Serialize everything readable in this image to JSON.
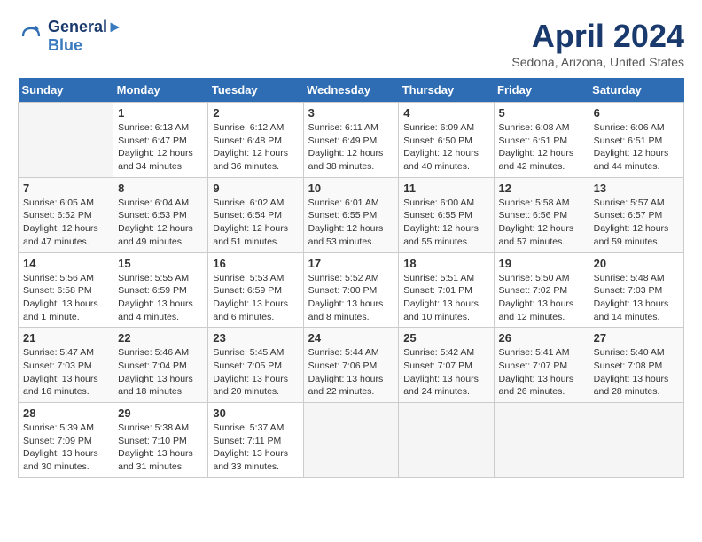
{
  "header": {
    "logo_line1": "General",
    "logo_line2": "Blue",
    "title": "April 2024",
    "location": "Sedona, Arizona, United States"
  },
  "calendar": {
    "days_of_week": [
      "Sunday",
      "Monday",
      "Tuesday",
      "Wednesday",
      "Thursday",
      "Friday",
      "Saturday"
    ],
    "weeks": [
      [
        {
          "day": "",
          "sunrise": "",
          "sunset": "",
          "daylight": ""
        },
        {
          "day": "1",
          "sunrise": "Sunrise: 6:13 AM",
          "sunset": "Sunset: 6:47 PM",
          "daylight": "Daylight: 12 hours and 34 minutes."
        },
        {
          "day": "2",
          "sunrise": "Sunrise: 6:12 AM",
          "sunset": "Sunset: 6:48 PM",
          "daylight": "Daylight: 12 hours and 36 minutes."
        },
        {
          "day": "3",
          "sunrise": "Sunrise: 6:11 AM",
          "sunset": "Sunset: 6:49 PM",
          "daylight": "Daylight: 12 hours and 38 minutes."
        },
        {
          "day": "4",
          "sunrise": "Sunrise: 6:09 AM",
          "sunset": "Sunset: 6:50 PM",
          "daylight": "Daylight: 12 hours and 40 minutes."
        },
        {
          "day": "5",
          "sunrise": "Sunrise: 6:08 AM",
          "sunset": "Sunset: 6:51 PM",
          "daylight": "Daylight: 12 hours and 42 minutes."
        },
        {
          "day": "6",
          "sunrise": "Sunrise: 6:06 AM",
          "sunset": "Sunset: 6:51 PM",
          "daylight": "Daylight: 12 hours and 44 minutes."
        }
      ],
      [
        {
          "day": "7",
          "sunrise": "Sunrise: 6:05 AM",
          "sunset": "Sunset: 6:52 PM",
          "daylight": "Daylight: 12 hours and 47 minutes."
        },
        {
          "day": "8",
          "sunrise": "Sunrise: 6:04 AM",
          "sunset": "Sunset: 6:53 PM",
          "daylight": "Daylight: 12 hours and 49 minutes."
        },
        {
          "day": "9",
          "sunrise": "Sunrise: 6:02 AM",
          "sunset": "Sunset: 6:54 PM",
          "daylight": "Daylight: 12 hours and 51 minutes."
        },
        {
          "day": "10",
          "sunrise": "Sunrise: 6:01 AM",
          "sunset": "Sunset: 6:55 PM",
          "daylight": "Daylight: 12 hours and 53 minutes."
        },
        {
          "day": "11",
          "sunrise": "Sunrise: 6:00 AM",
          "sunset": "Sunset: 6:55 PM",
          "daylight": "Daylight: 12 hours and 55 minutes."
        },
        {
          "day": "12",
          "sunrise": "Sunrise: 5:58 AM",
          "sunset": "Sunset: 6:56 PM",
          "daylight": "Daylight: 12 hours and 57 minutes."
        },
        {
          "day": "13",
          "sunrise": "Sunrise: 5:57 AM",
          "sunset": "Sunset: 6:57 PM",
          "daylight": "Daylight: 12 hours and 59 minutes."
        }
      ],
      [
        {
          "day": "14",
          "sunrise": "Sunrise: 5:56 AM",
          "sunset": "Sunset: 6:58 PM",
          "daylight": "Daylight: 13 hours and 1 minute."
        },
        {
          "day": "15",
          "sunrise": "Sunrise: 5:55 AM",
          "sunset": "Sunset: 6:59 PM",
          "daylight": "Daylight: 13 hours and 4 minutes."
        },
        {
          "day": "16",
          "sunrise": "Sunrise: 5:53 AM",
          "sunset": "Sunset: 6:59 PM",
          "daylight": "Daylight: 13 hours and 6 minutes."
        },
        {
          "day": "17",
          "sunrise": "Sunrise: 5:52 AM",
          "sunset": "Sunset: 7:00 PM",
          "daylight": "Daylight: 13 hours and 8 minutes."
        },
        {
          "day": "18",
          "sunrise": "Sunrise: 5:51 AM",
          "sunset": "Sunset: 7:01 PM",
          "daylight": "Daylight: 13 hours and 10 minutes."
        },
        {
          "day": "19",
          "sunrise": "Sunrise: 5:50 AM",
          "sunset": "Sunset: 7:02 PM",
          "daylight": "Daylight: 13 hours and 12 minutes."
        },
        {
          "day": "20",
          "sunrise": "Sunrise: 5:48 AM",
          "sunset": "Sunset: 7:03 PM",
          "daylight": "Daylight: 13 hours and 14 minutes."
        }
      ],
      [
        {
          "day": "21",
          "sunrise": "Sunrise: 5:47 AM",
          "sunset": "Sunset: 7:03 PM",
          "daylight": "Daylight: 13 hours and 16 minutes."
        },
        {
          "day": "22",
          "sunrise": "Sunrise: 5:46 AM",
          "sunset": "Sunset: 7:04 PM",
          "daylight": "Daylight: 13 hours and 18 minutes."
        },
        {
          "day": "23",
          "sunrise": "Sunrise: 5:45 AM",
          "sunset": "Sunset: 7:05 PM",
          "daylight": "Daylight: 13 hours and 20 minutes."
        },
        {
          "day": "24",
          "sunrise": "Sunrise: 5:44 AM",
          "sunset": "Sunset: 7:06 PM",
          "daylight": "Daylight: 13 hours and 22 minutes."
        },
        {
          "day": "25",
          "sunrise": "Sunrise: 5:42 AM",
          "sunset": "Sunset: 7:07 PM",
          "daylight": "Daylight: 13 hours and 24 minutes."
        },
        {
          "day": "26",
          "sunrise": "Sunrise: 5:41 AM",
          "sunset": "Sunset: 7:07 PM",
          "daylight": "Daylight: 13 hours and 26 minutes."
        },
        {
          "day": "27",
          "sunrise": "Sunrise: 5:40 AM",
          "sunset": "Sunset: 7:08 PM",
          "daylight": "Daylight: 13 hours and 28 minutes."
        }
      ],
      [
        {
          "day": "28",
          "sunrise": "Sunrise: 5:39 AM",
          "sunset": "Sunset: 7:09 PM",
          "daylight": "Daylight: 13 hours and 30 minutes."
        },
        {
          "day": "29",
          "sunrise": "Sunrise: 5:38 AM",
          "sunset": "Sunset: 7:10 PM",
          "daylight": "Daylight: 13 hours and 31 minutes."
        },
        {
          "day": "30",
          "sunrise": "Sunrise: 5:37 AM",
          "sunset": "Sunset: 7:11 PM",
          "daylight": "Daylight: 13 hours and 33 minutes."
        },
        {
          "day": "",
          "sunrise": "",
          "sunset": "",
          "daylight": ""
        },
        {
          "day": "",
          "sunrise": "",
          "sunset": "",
          "daylight": ""
        },
        {
          "day": "",
          "sunrise": "",
          "sunset": "",
          "daylight": ""
        },
        {
          "day": "",
          "sunrise": "",
          "sunset": "",
          "daylight": ""
        }
      ]
    ]
  }
}
